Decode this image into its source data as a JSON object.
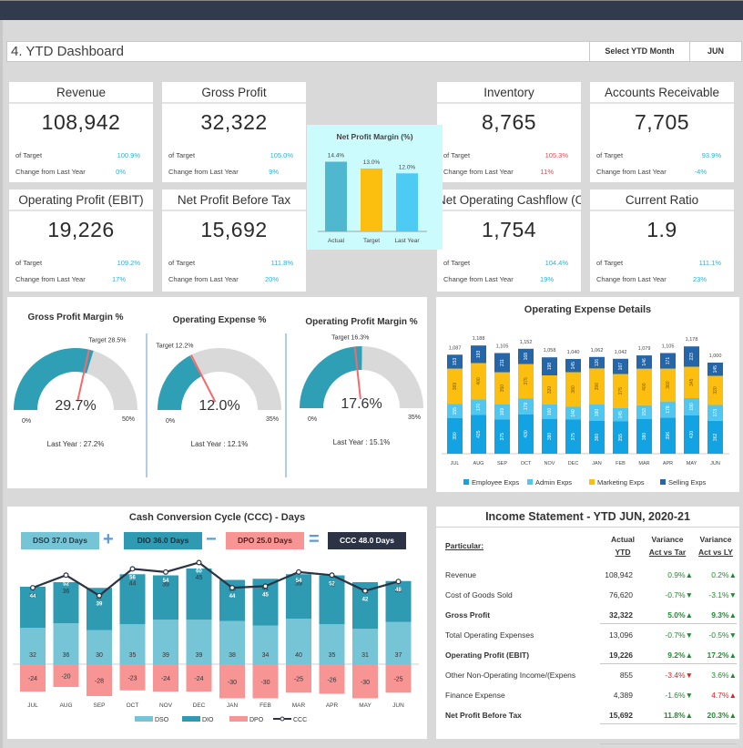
{
  "header": {
    "title": "4. YTD Dashboard",
    "select_label": "Select YTD Month",
    "select_value": "JUN"
  },
  "kpis": [
    {
      "name": "revenue",
      "title": "Revenue",
      "value": "108,942",
      "target_label": "of Target",
      "target_value": "100.9%",
      "target_color": "blue",
      "change_label": "Change from Last Year",
      "change_value": "0%",
      "change_color": "blue"
    },
    {
      "name": "gross-profit",
      "title": "Gross Profit",
      "value": "32,322",
      "target_label": "of Target",
      "target_value": "105.0%",
      "target_color": "blue",
      "change_label": "Change from Last Year",
      "change_value": "9%",
      "change_color": "blue"
    },
    {
      "name": "inventory",
      "title": "Inventory",
      "value": "8,765",
      "target_label": "of Target",
      "target_value": "105.3%",
      "target_color": "red",
      "change_label": "Change from Last Year",
      "change_value": "11%",
      "change_color": "red"
    },
    {
      "name": "accounts-receivable",
      "title": "Accounts Receivable",
      "value": "7,705",
      "target_label": "of Target",
      "target_value": "93.9%",
      "target_color": "blue",
      "change_label": "Change from Last Year",
      "change_value": "-4%",
      "change_color": "blue"
    },
    {
      "name": "operating-profit",
      "title": "Operating Profit (EBIT)",
      "value": "19,226",
      "target_label": "of Target",
      "target_value": "109.2%",
      "target_color": "blue",
      "change_label": "Change from Last Year",
      "change_value": "17%",
      "change_color": "blue"
    },
    {
      "name": "net-profit-before-tax",
      "title": "Net Profit Before Tax",
      "value": "15,692",
      "target_label": "of Target",
      "target_value": "111.8%",
      "target_color": "blue",
      "change_label": "Change from Last Year",
      "change_value": "20%",
      "change_color": "blue"
    },
    {
      "name": "net-operating-cashflow",
      "title": "Net Operating Cashflow (OCF",
      "value": "1,754",
      "target_label": "of Target",
      "target_value": "104.4%",
      "target_color": "blue",
      "change_label": "Change from Last Year",
      "change_value": "19%",
      "change_color": "blue"
    },
    {
      "name": "current-ratio",
      "title": "Current Ratio",
      "value": "1.9",
      "target_label": "of Target",
      "target_value": "111.1%",
      "target_color": "blue",
      "change_label": "Change from Last Year",
      "change_value": "23%",
      "change_color": "blue"
    }
  ],
  "gauges": [
    {
      "title": "Gross Profit Margin %",
      "value": 29.7,
      "value_label": "29.7%",
      "target": 28.5,
      "target_label": "Target 28.5%",
      "min_label": "0%",
      "max_label": "50%",
      "max": 50,
      "last_year": "Last Year : 27.2%"
    },
    {
      "title": "Operating Expense %",
      "value": 12.0,
      "value_label": "12.0%",
      "target": 12.2,
      "target_label": "Target 12.2%",
      "min_label": "0%",
      "max_label": "35%",
      "max": 35,
      "last_year": "Last Year : 12.1%"
    },
    {
      "title": "Operating Profit Margin %",
      "value": 17.6,
      "value_label": "17.6%",
      "target": 16.3,
      "target_label": "Target 16.3%",
      "min_label": "0%",
      "max_label": "35%",
      "max": 35,
      "last_year": "Last Year : 15.1%"
    }
  ],
  "colors": {
    "teal": "#2e9fb5",
    "gauge_bg": "#d9d9d9",
    "target_marker": "#f36a6a",
    "dso": "#76c5d6",
    "dio": "#2e9bb3",
    "dpo": "#f79494",
    "ccc": "#2b3344",
    "employee": "#13a3e3",
    "admin": "#4fc7f0",
    "marketing": "#fdbf0f",
    "selling": "#2466a8"
  },
  "chart_data": [
    {
      "type": "bar",
      "title": "Net Profit Margin (%)",
      "categories": [
        "Actual",
        "Target",
        "Last Year"
      ],
      "values": [
        14.4,
        13.0,
        12.0
      ],
      "labels": [
        "14.4%",
        "13.0%",
        "12.0%"
      ],
      "colors": [
        "#4fb8cf",
        "#fdbf0f",
        "#4ecbf5"
      ],
      "ylim": [
        0,
        16
      ]
    },
    {
      "type": "bar",
      "stacked": true,
      "title": "Operating Expense Details",
      "categories": [
        "JUL",
        "AUG",
        "SEP",
        "OCT",
        "NOV",
        "DEC",
        "JAN",
        "FEB",
        "MAR",
        "APR",
        "MAY",
        "JUN"
      ],
      "series": [
        {
          "name": "Employee Exps",
          "values": [
            390,
            425,
            375,
            430,
            380,
            375,
            360,
            355,
            380,
            396,
            420,
            362
          ]
        },
        {
          "name": "Admin Exps",
          "values": [
            155,
            170,
            169,
            179,
            160,
            140,
            180,
            145,
            153,
            178,
            190,
            173
          ]
        },
        {
          "name": "Marketing Exps",
          "values": [
            389,
            400,
            350,
            375,
            320,
            380,
            396,
            375,
            400,
            360,
            345,
            320
          ]
        },
        {
          "name": "Selling Exps",
          "values": [
            153,
            193,
            211,
            168,
            198,
            145,
            126,
            167,
            146,
            171,
            223,
            145
          ]
        }
      ],
      "totals": [
        "1,087",
        "1,188",
        "1,105",
        "1,152",
        "1,058",
        "1,040",
        "1,062",
        "1,042",
        "1,079",
        "1,105",
        "1,178",
        "1,000"
      ],
      "legend": "bottom"
    },
    {
      "type": "bar",
      "stacked": true,
      "title": "Cash Conversion Cycle (CCC) - Days",
      "categories": [
        "JUL",
        "AUG",
        "SEP",
        "OCT",
        "NOV",
        "DEC",
        "JAN",
        "FEB",
        "MAR",
        "APR",
        "MAY",
        "JUN"
      ],
      "series": [
        {
          "name": "DSO",
          "values": [
            32,
            36,
            30,
            35,
            39,
            39,
            38,
            34,
            40,
            35,
            31,
            37
          ]
        },
        {
          "name": "DIO",
          "values": [
            36,
            36,
            37,
            44,
            39,
            45,
            36,
            41,
            39,
            43,
            41,
            36
          ]
        },
        {
          "name": "DPO",
          "values": [
            -24,
            -20,
            -28,
            -23,
            -24,
            -24,
            -30,
            -30,
            -25,
            -26,
            -30,
            -25
          ]
        },
        {
          "name": "CCC",
          "type": "line",
          "values": [
            44,
            52,
            39,
            56,
            54,
            60,
            44,
            45,
            54,
            52,
            42,
            48
          ]
        }
      ],
      "summary": [
        {
          "label": "DSO 37.0 Days",
          "op": "+"
        },
        {
          "label": "DIO 36.0 Days",
          "op": "−"
        },
        {
          "label": "DPO 25.0 Days",
          "op": "="
        },
        {
          "label": "CCC 48.0 Days",
          "op": ""
        }
      ],
      "legend": "bottom"
    }
  ],
  "income_statement": {
    "title": "Income Statement - YTD JUN, 2020-21",
    "headers": {
      "particular": "Particular:",
      "actual_1": "Actual",
      "actual_2": "YTD",
      "var_tar_1": "Variance",
      "var_tar_2": "Act vs Tar",
      "var_ly_1": "Variance",
      "var_ly_2": "Act vs LY"
    },
    "rows": [
      {
        "particular": "Revenue",
        "actual": "108,942",
        "vs_tar": "0.9%▲",
        "vs_tar_color": "g",
        "vs_ly": "0.2%▲",
        "vs_ly_color": "g",
        "bold": false
      },
      {
        "particular": "Cost of Goods Sold",
        "actual": "76,620",
        "vs_tar": "-0.7%▼",
        "vs_tar_color": "g",
        "vs_ly": "-3.1%▼",
        "vs_ly_color": "g",
        "bold": false
      },
      {
        "particular": "Gross Profit",
        "actual": "32,322",
        "vs_tar": "5.0%▲",
        "vs_tar_color": "g",
        "vs_ly": "9.3%▲",
        "vs_ly_color": "g",
        "bold": true
      },
      {
        "particular": "Total Operating Expenses",
        "actual": "13,096",
        "vs_tar": "-0.7%▼",
        "vs_tar_color": "g",
        "vs_ly": "-0.5%▼",
        "vs_ly_color": "g",
        "bold": false
      },
      {
        "particular": "Operating Profit (EBIT)",
        "actual": "19,226",
        "vs_tar": "9.2%▲",
        "vs_tar_color": "g",
        "vs_ly": "17.2%▲",
        "vs_ly_color": "g",
        "bold": true
      },
      {
        "particular": "Other Non-Operating Income/(Expens",
        "actual": "855",
        "vs_tar": "-3.4%▼",
        "vs_tar_color": "r",
        "vs_ly": "3.6%▲",
        "vs_ly_color": "g",
        "bold": false
      },
      {
        "particular": "Finance Expense",
        "actual": "4,389",
        "vs_tar": "-1.6%▼",
        "vs_tar_color": "g",
        "vs_ly": "4.7%▲",
        "vs_ly_color": "r",
        "bold": false
      },
      {
        "particular": "Net Profit Before Tax",
        "actual": "15,692",
        "vs_tar": "11.8%▲",
        "vs_tar_color": "g",
        "vs_ly": "20.3%▲",
        "vs_ly_color": "g",
        "bold": true
      }
    ]
  }
}
